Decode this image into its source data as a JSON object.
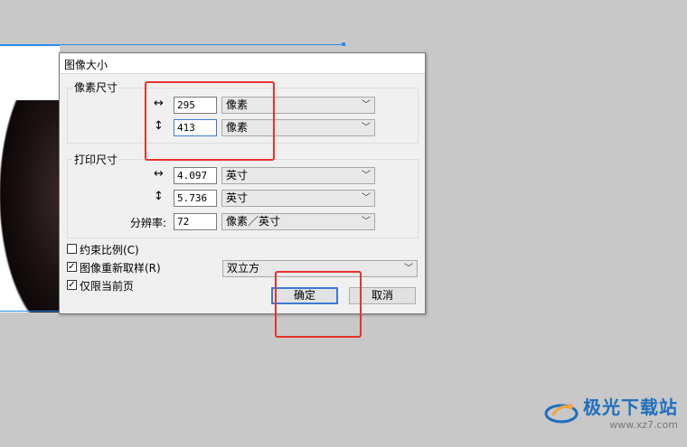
{
  "dialog": {
    "title": "图像大小"
  },
  "pixel_dimensions": {
    "label": "像素尺寸",
    "width": {
      "icon": "horizontal-arrow-icon",
      "glyph": "↔",
      "value": "295",
      "unit": "像素"
    },
    "height": {
      "icon": "vertical-arrow-icon",
      "glyph": "↕",
      "value": "413",
      "unit": "像素"
    }
  },
  "print_size": {
    "label": "打印尺寸",
    "width": {
      "icon": "horizontal-arrow-icon",
      "glyph": "↔",
      "value": "4.097",
      "unit": "英寸"
    },
    "height": {
      "icon": "vertical-arrow-icon",
      "glyph": "↕",
      "value": "5.736",
      "unit": "英寸"
    },
    "resolution": {
      "label": "分辨率:",
      "value": "72",
      "unit": "像素／英寸"
    }
  },
  "options": {
    "constrain": {
      "label": "约束比例(C)",
      "checked": false
    },
    "resample": {
      "label": "图像重新取样(R)",
      "checked": true,
      "method": "双立方"
    },
    "current_page": {
      "label": "仅限当前页",
      "checked": true
    }
  },
  "buttons": {
    "ok": "确定",
    "cancel": "取消"
  },
  "watermark": {
    "title": "极光下载站",
    "url": "www.xz7.com"
  },
  "colors": {
    "highlight": "#e8322c",
    "focus": "#3a7bd5",
    "watermark": "#1f6fbf"
  }
}
